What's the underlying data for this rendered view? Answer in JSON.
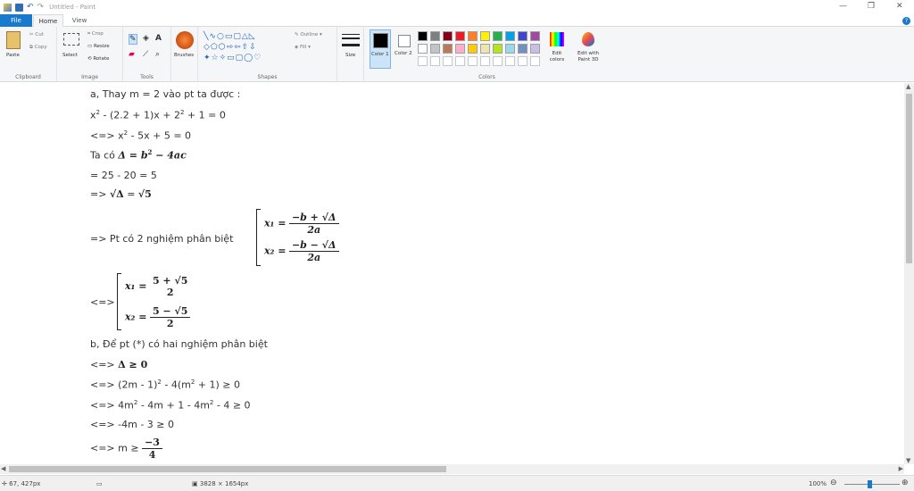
{
  "window": {
    "title": "Untitled - Paint",
    "minimize": "—",
    "maximize": "❐",
    "close": "✕"
  },
  "tabs": {
    "file": "File",
    "home": "Home",
    "view": "View",
    "help": "?"
  },
  "ribbon": {
    "clipboard": {
      "label": "Clipboard",
      "paste": "Paste",
      "cut": "Cut",
      "copy": "Copy"
    },
    "image": {
      "label": "Image",
      "select": "Select",
      "crop": "Crop",
      "resize": "Resize",
      "rotate": "Rotate"
    },
    "tools": {
      "label": "Tools"
    },
    "brushes": {
      "label": "Brushes"
    },
    "shapes": {
      "label": "Shapes",
      "outline": "Outline",
      "fill": "Fill"
    },
    "size": {
      "label": "Size"
    },
    "colors": {
      "label": "Colors",
      "color1": "Color 1",
      "color2": "Color 2",
      "edit_colors": "Edit colors",
      "edit_paint3d": "Edit with Paint 3D",
      "color1_value": "#000000",
      "color2_value": "#ffffff",
      "palette_row1": [
        "#000000",
        "#7f7f7f",
        "#880015",
        "#ed1c24",
        "#ff7f27",
        "#fff200",
        "#22b14c",
        "#00a2e8",
        "#3f48cc",
        "#a349a4"
      ],
      "palette_row2": [
        "#ffffff",
        "#c3c3c3",
        "#b97a57",
        "#ffaec9",
        "#ffc90e",
        "#efe4b0",
        "#b5e61d",
        "#99d9ea",
        "#7092be",
        "#c8bfe7"
      ]
    }
  },
  "canvas": {
    "l1": "a, Thay m = 2 vào pt ta được :",
    "l2a": "x",
    "l2b": "2",
    "l2c": " - (2.2 + 1)x + 2",
    "l2d": "2",
    "l2e": " + 1 = 0",
    "l3a": "<=> x",
    "l3b": "2",
    "l3c": " - 5x + 5 = 0",
    "l4a": "Ta có ",
    "l4b": "Δ = b",
    "l4c": "2",
    "l4d": " − 4ac",
    "l5": "= 25 - 20 = 5",
    "l6a": "=> ",
    "l6b": "√Δ",
    "l6c": " = ",
    "l6d": "√5",
    "l7": "=> Pt có 2 nghiệm phân biệt",
    "x1": "x₁ =",
    "x1num": "−b + √Δ",
    "x1den": "2a",
    "x2": "x₂ =",
    "x2num": "−b − √Δ",
    "x2den": "2a",
    "l8": "<=>",
    "y1": "x₁ =",
    "y1num": "5 + √5",
    "y1den": "2",
    "y2": "x₂ =",
    "y2num": "5 − √5",
    "y2den": "2",
    "l9": "b, Để pt (*) có hai nghiệm phân biệt",
    "l10a": "<=> ",
    "l10b": "Δ ≥ 0",
    "l11a": "<=> (2m - 1)",
    "l11b": "2",
    "l11c": " - 4(m",
    "l11d": "2",
    "l11e": " + 1) ≥ 0",
    "l12a": "<=> 4m",
    "l12b": "2",
    "l12c": " - 4m + 1 - 4m",
    "l12d": "2",
    "l12e": " - 4 ≥ 0",
    "l13": "<=> -4m - 3 ≥ 0",
    "l14a": "<=> m ≥ ",
    "l14num": "−3",
    "l14den": "4"
  },
  "status": {
    "cursor": "67, 427px",
    "size": "3828 × 1654px",
    "zoom": "100%"
  }
}
